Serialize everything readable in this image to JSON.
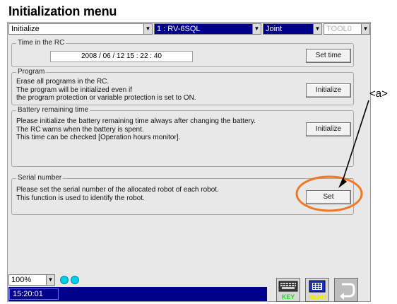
{
  "page_title": "Initialization menu",
  "toolbar": {
    "mode_select": "Initialize",
    "robot_select": "1 : RV-6SQL",
    "frame_select": "Joint",
    "tool_select": "TOOL0"
  },
  "time_group": {
    "legend": "Time in the RC",
    "datetime": "2008 / 06 / 12   15 : 22 : 40",
    "button": "Set time"
  },
  "program_group": {
    "legend": "Program",
    "lines": [
      "Erase all programs in the RC.",
      "The program will be initialized even if",
      "the program protection or variable protection is set to ON."
    ],
    "button": "Initialize"
  },
  "battery_group": {
    "legend": "Battery remaining time",
    "lines": [
      "Please initialize the battery remaining time always after changing the battery.",
      "The RC warns when the battery is spent.",
      "This time can be checked [Operation hours monitor]."
    ],
    "button": "Initialize"
  },
  "serial_group": {
    "legend": "Serial number",
    "lines": [
      "Please set the serial number of the allocated robot of each robot.",
      "This function is used to identify the robot."
    ],
    "button": "Set"
  },
  "footer": {
    "zoom": "100%",
    "clock": "15:20:01",
    "key_label": "KEY",
    "menu_label": "MENU"
  },
  "annotation": {
    "label": "<a>",
    "color": "#f07820"
  },
  "colors": {
    "status_bar": "#00008a",
    "panel": "#e8e8e8",
    "indicator": "#00cfe8"
  }
}
